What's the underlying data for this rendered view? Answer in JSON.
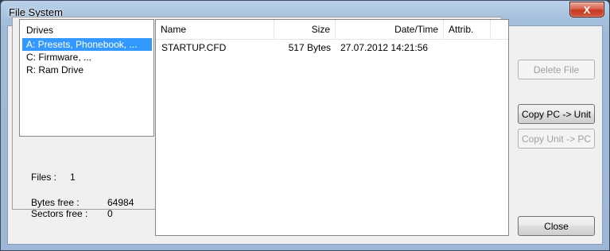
{
  "window": {
    "title": "File System",
    "close_label": "X"
  },
  "drives": {
    "header": "Drives",
    "items": [
      {
        "label": "A: Presets, Phonebook, ...",
        "selected": true
      },
      {
        "label": "C: Firmware, ...",
        "selected": false
      },
      {
        "label": "R: Ram Drive",
        "selected": false
      }
    ]
  },
  "info": {
    "files_label": "Files :",
    "files_value": "1",
    "bytes_free_label": "Bytes free :",
    "bytes_free_value": "64984",
    "sectors_free_label": "Sectors free :",
    "sectors_free_value": "0"
  },
  "file_list": {
    "columns": [
      "Name",
      "Size",
      "Date/Time",
      "Attrib."
    ],
    "rows": [
      {
        "name": "STARTUP.CFD",
        "size": "517 Bytes",
        "datetime": "27.07.2012 14:21:56",
        "attrib": ""
      }
    ]
  },
  "buttons": {
    "delete_file": "Delete File",
    "copy_pc_to_unit": "Copy PC -> Unit",
    "copy_unit_to_pc": "Copy Unit -> PC",
    "close": "Close"
  }
}
